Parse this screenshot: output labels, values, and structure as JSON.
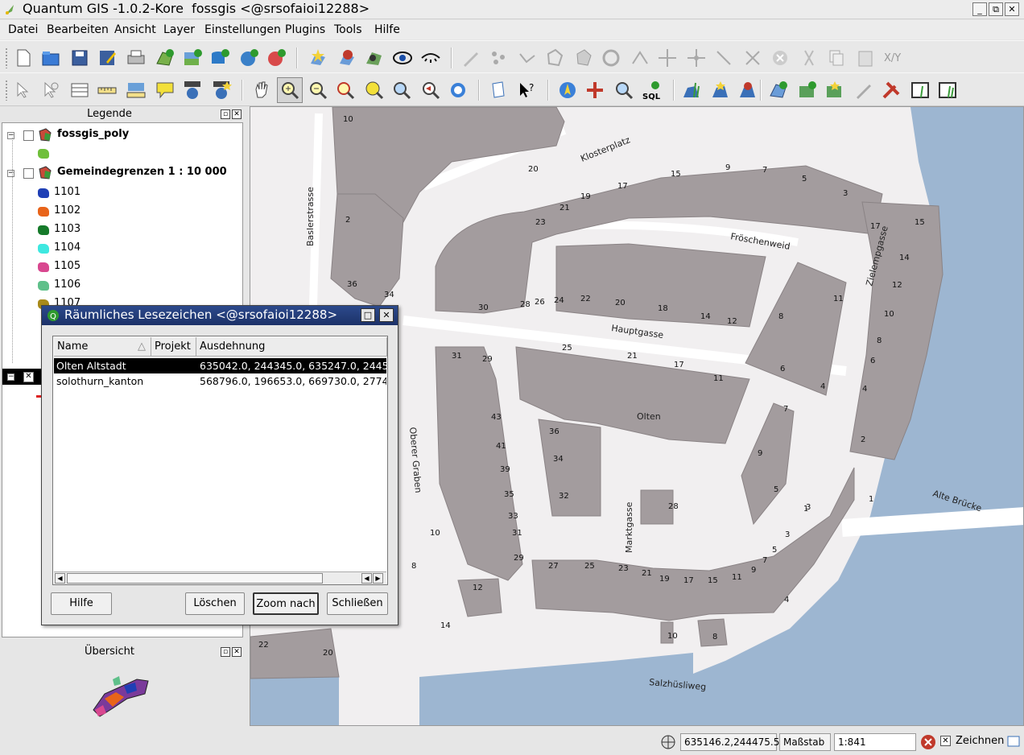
{
  "window": {
    "title": "Quantum GIS -1.0.2-Kore  fossgis <@srsofaioi12288>",
    "controls": [
      "_",
      "⧉",
      "✕"
    ]
  },
  "menu": [
    "Datei",
    "Bearbeiten",
    "Ansicht",
    "Layer",
    "Einstellungen",
    "Plugins",
    "Tools",
    "Hilfe"
  ],
  "toolbar": {
    "xy_label": "X/Y"
  },
  "legend": {
    "title": "Legende",
    "layers": [
      {
        "name": "fossgis_poly"
      },
      {
        "name": "Gemeindegrenzen 1 : 10 000"
      }
    ],
    "classes": [
      {
        "label": "1101",
        "color": "#1f3fb5"
      },
      {
        "label": "1102",
        "color": "#e8641a"
      },
      {
        "label": "1103",
        "color": "#157a2a"
      },
      {
        "label": "1104",
        "color": "#3ee8e0"
      },
      {
        "label": "1105",
        "color": "#d8478f"
      },
      {
        "label": "1106",
        "color": "#5fc08a"
      },
      {
        "label": "1107",
        "color": "#a88a1a"
      }
    ],
    "poly_color": "#6fbf3a"
  },
  "overview": {
    "title": "Übersicht"
  },
  "map": {
    "labels": [
      "Klosterplatz",
      "Baslerstrasse",
      "Fröschenweid",
      "Hauptgasse",
      "Zielempgasse",
      "Oberer Graben",
      "Olten",
      "Marktgasse",
      "Alte Brücke",
      "Salzhüsliweg"
    ],
    "numbers": [
      "10",
      "20",
      "2",
      "36",
      "34",
      "30",
      "28",
      "26",
      "24",
      "22",
      "20",
      "18",
      "14",
      "12",
      "23",
      "21",
      "19",
      "17",
      "15",
      "9",
      "7",
      "5",
      "3",
      "17",
      "15",
      "14",
      "12",
      "10",
      "8",
      "6",
      "4",
      "2",
      "8",
      "11",
      "6",
      "4",
      "25",
      "21",
      "17",
      "11",
      "7",
      "9",
      "5",
      "3",
      "1",
      "31",
      "29",
      "43",
      "41",
      "39",
      "35",
      "33",
      "31",
      "29",
      "36",
      "34",
      "32",
      "28",
      "27",
      "25",
      "23",
      "21",
      "19",
      "17",
      "15",
      "11",
      "9",
      "7",
      "5",
      "3",
      "1",
      "4",
      "12",
      "10",
      "8",
      "14",
      "22",
      "20",
      "10",
      "8"
    ]
  },
  "status": {
    "coords": "635146.2,244475.5",
    "scale_label": "Maßstab",
    "scale_value": "1:841",
    "render_label": "Zeichnen"
  },
  "dialog": {
    "title": "Räumliches Lesezeichen <@srsofaioi12288>",
    "columns": [
      "Name",
      "Projekt",
      "Ausdehnung"
    ],
    "rows": [
      {
        "name": "Olten Altstadt",
        "project": "",
        "extent": "635042.0, 244345.0, 635247.0, 2445",
        "selected": true
      },
      {
        "name": "solothurn_kanton",
        "project": "",
        "extent": "568796.0, 196653.0, 669730.0, 2774",
        "selected": false
      }
    ],
    "buttons": {
      "help": "Hilfe",
      "delete": "Löschen",
      "zoom": "Zoom nach",
      "close": "Schließen"
    }
  }
}
